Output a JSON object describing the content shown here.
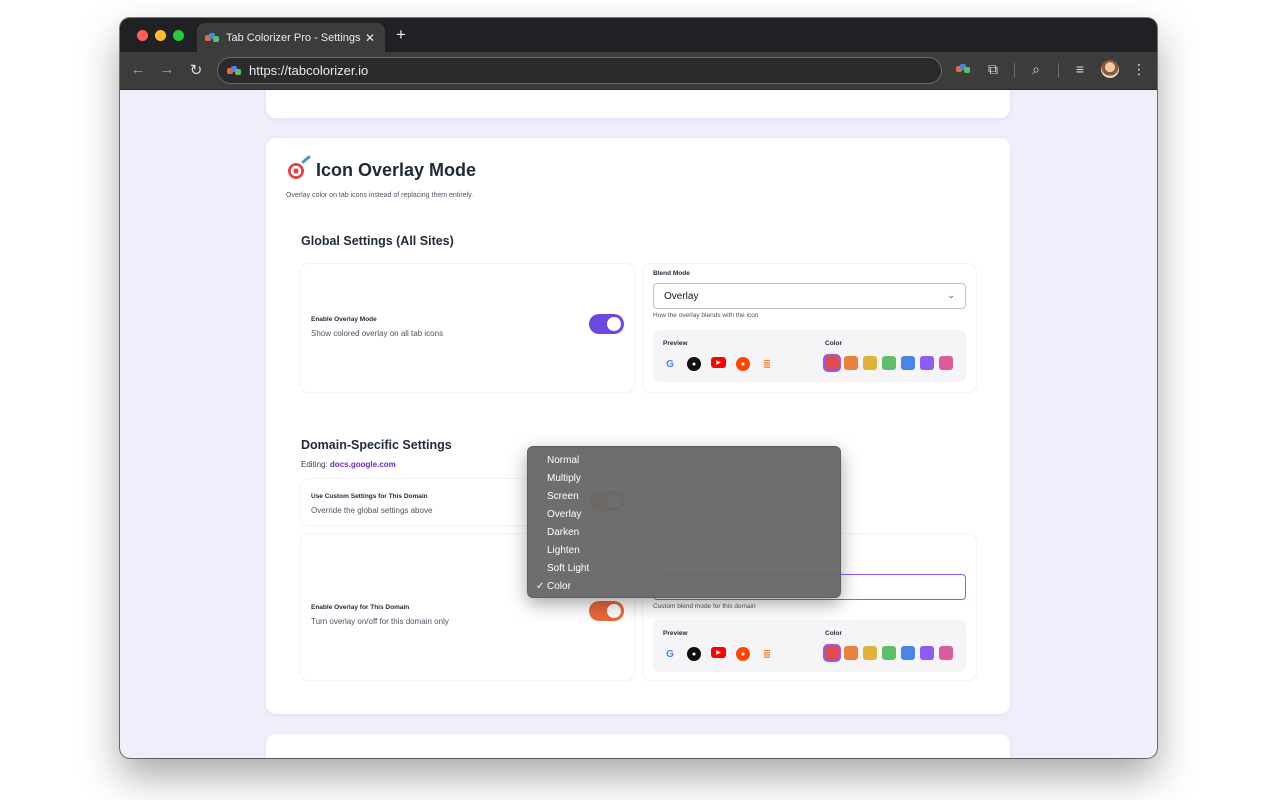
{
  "browser": {
    "tab_title": "Tab Colorizer Pro - Settings",
    "url": "https://tabcolorizer.io",
    "new_tab": "+",
    "close": "✕"
  },
  "page": {
    "section_title": "Icon Overlay Mode",
    "section_subtitle": "Overlay color on tab icons instead of replacing them entirely.",
    "global": {
      "title": "Global Settings (All Sites)",
      "enable_label": "Enable Overlay Mode",
      "enable_desc": "Show colored overlay on all tab icons",
      "enable_on": true,
      "blend_label": "Blend Mode",
      "blend_value": "Overlay",
      "blend_hint": "How the overlay blends with the icon",
      "preview_label": "Preview",
      "color_label": "Color"
    },
    "domain": {
      "title": "Domain-Specific Settings",
      "editing_prefix": "Editing:",
      "editing_domain": "docs.google.com",
      "custom_label": "Use Custom Settings for This Domain",
      "custom_desc": "Override the global settings above",
      "custom_on": true,
      "enable_label": "Enable Overlay for This Domain",
      "enable_desc": "Turn overlay on/off for this domain only",
      "enable_on": true,
      "blend_hint": "Custom blend mode for this domain",
      "preview_label": "Preview",
      "color_label": "Color"
    },
    "swatch_colors": [
      "#e04b4b",
      "#e8813a",
      "#e0b23a",
      "#5cc06a",
      "#4a86e8",
      "#8b5cf6",
      "#de5c9e"
    ],
    "selected_swatch": 0,
    "preview_sites": [
      "google",
      "github",
      "youtube",
      "reddit",
      "stackoverflow"
    ]
  },
  "dropdown": {
    "options": [
      "Normal",
      "Multiply",
      "Screen",
      "Overlay",
      "Darken",
      "Lighten",
      "Soft Light",
      "Color"
    ],
    "selected": "Color"
  }
}
